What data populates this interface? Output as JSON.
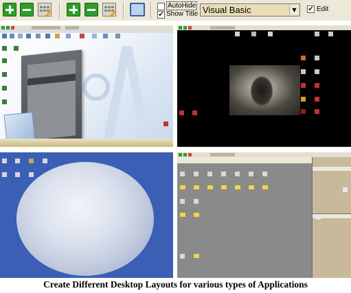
{
  "toolbar": {
    "buttons": [
      {
        "name": "add",
        "icon": "plus-icon"
      },
      {
        "name": "remove",
        "icon": "minus-icon"
      },
      {
        "name": "edit-layout",
        "icon": "keyboard-pencil-icon"
      },
      {
        "name": "add",
        "icon": "plus-icon"
      },
      {
        "name": "remove",
        "icon": "minus-icon"
      },
      {
        "name": "edit-layout",
        "icon": "keyboard-pencil-icon"
      },
      {
        "name": "desktop",
        "icon": "monitor-icon"
      }
    ],
    "autohide": {
      "label": "AutoHide",
      "checked": false
    },
    "show_title": {
      "label": "Show Title",
      "checked": true
    },
    "layout_select": {
      "value": "Visual Basic"
    },
    "edit": {
      "label": "Edit",
      "checked": true
    }
  },
  "previews": {
    "q1": {
      "theme": "office-white",
      "bg": "#dbe6f3"
    },
    "q2": {
      "theme": "dark-game",
      "bg": "#000000"
    },
    "q3": {
      "theme": "moon",
      "bg": "#3a5fb5"
    },
    "q4": {
      "theme": "visual-basic-grey",
      "bg": "#8a8a8a"
    }
  },
  "caption": "Create Different Desktop Layouts for various types of Applications",
  "colors": {
    "accent_green": "#2e9e2a",
    "toolbar_bg": "#ece9d8",
    "combo_bg": "#e8ddb6"
  }
}
